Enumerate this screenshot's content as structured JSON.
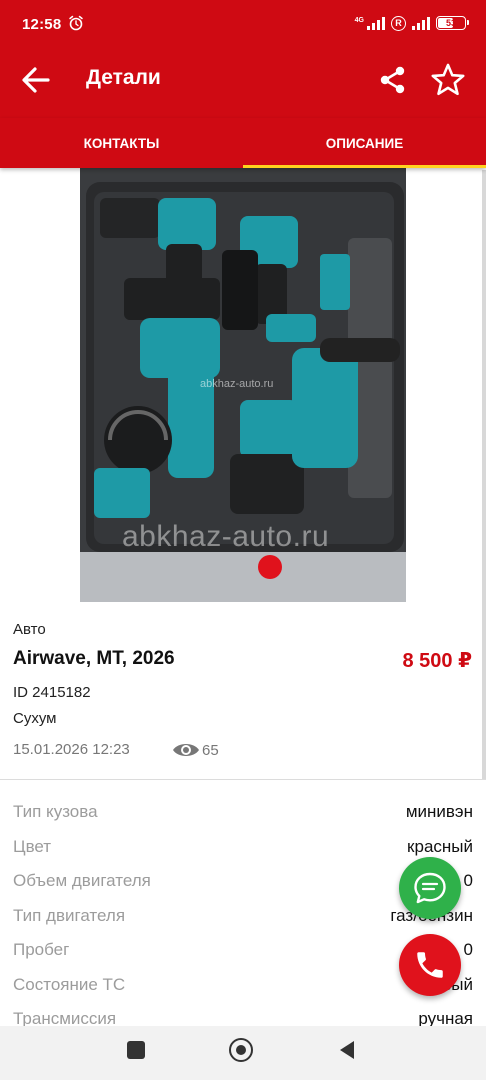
{
  "status_bar": {
    "time": "12:58",
    "network": "4G",
    "registration": "R",
    "battery": "53"
  },
  "app_bar": {
    "title": "Детали",
    "back_icon": "arrow-left-icon",
    "share_icon": "share-icon",
    "favorite_icon": "star-outline-icon"
  },
  "tabs": [
    {
      "label": "КОНТАКТЫ",
      "active": false
    },
    {
      "label": "ОПИСАНИЕ",
      "active": true
    }
  ],
  "photo": {
    "watermark_small": "abkhaz-auto.ru",
    "watermark_large": "abkhaz-auto.ru"
  },
  "listing": {
    "category": "Авто",
    "title": "Airwave, MT, 2026",
    "price": "8 500 ₽",
    "id": "ID 2415182",
    "city": "Сухум",
    "date": "15.01.2026 12:23",
    "views": "65"
  },
  "specs": [
    {
      "label": "Тип кузова",
      "value": "минивэн"
    },
    {
      "label": "Цвет",
      "value": "красный"
    },
    {
      "label": "Объем двигателя",
      "value": "0"
    },
    {
      "label": "Тип двигателя",
      "value": "газ/бензин"
    },
    {
      "label": "Пробег",
      "value": "0"
    },
    {
      "label": "Состояние ТС",
      "value": "новый"
    },
    {
      "label": "Трансмиссия",
      "value": "ручная"
    }
  ],
  "colors": {
    "brand": "#cf0a13",
    "tab_indicator": "#ffd21f",
    "chat_fab": "#2fb14a",
    "call_fab": "#e0121c"
  }
}
